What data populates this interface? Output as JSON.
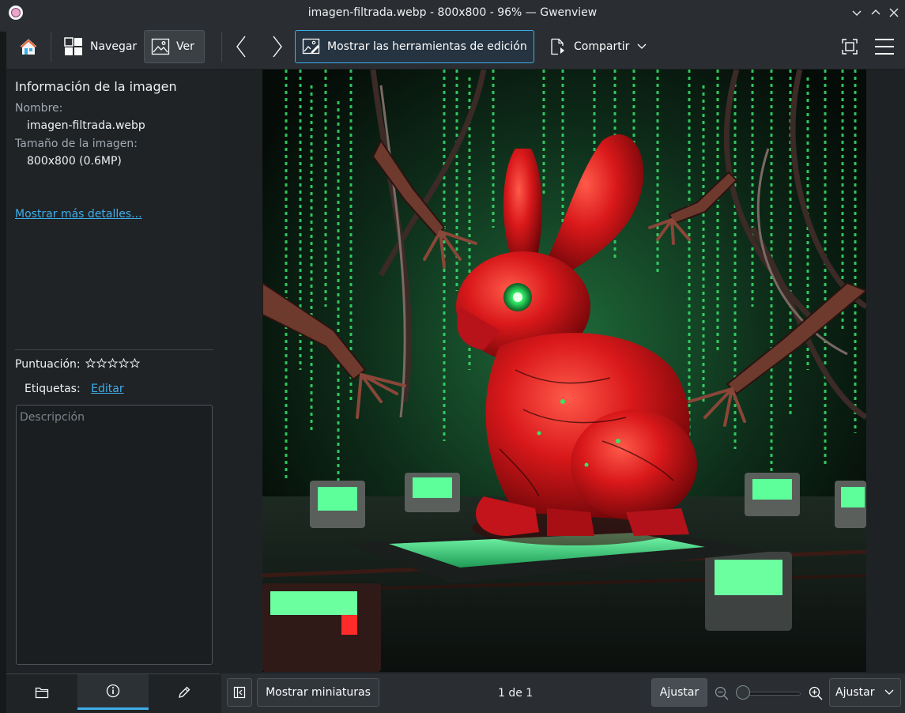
{
  "window": {
    "title": "imagen-filtrada.webp - 800x800 - 96% — Gwenview"
  },
  "toolbar": {
    "browse_label": "Navegar",
    "view_label": "Ver",
    "edit_tools_label": "Mostrar las herramientas de edición",
    "share_label": "Compartir"
  },
  "sidebar": {
    "section_title": "Información de la imagen",
    "name_label": "Nombre:",
    "name_value": "imagen-filtrada.webp",
    "size_label": "Tamaño de la imagen:",
    "size_value": "800x800 (0.6MP)",
    "more_details_link": "Mostrar más detalles...",
    "rating_label": "Puntuación:",
    "rating_value": 0,
    "rating_max": 5,
    "tags_label": "Etiquetas:",
    "tags_edit_link": "Editar",
    "description_placeholder": "Descripción"
  },
  "bottombar": {
    "thumbnails_label": "Mostrar miniaturas",
    "page_counter": "1 de 1",
    "fit_button_label": "Ajustar",
    "zoom_select_value": "Ajustar"
  },
  "icons": {
    "home": "home-icon",
    "browse": "grid-icon",
    "view": "image-icon",
    "previous": "chevron-left-icon",
    "next": "chevron-right-icon",
    "edit_tools": "image-edit-icon",
    "share": "share-icon",
    "fullscreen": "fullscreen-icon",
    "menu": "hamburger-menu-icon",
    "folder_tab": "folder-icon",
    "info_tab": "info-icon",
    "edit_tab": "pencil-icon",
    "sidebar_toggle": "sidebar-toggle-icon",
    "zoom_out": "zoom-out-icon",
    "zoom_in": "zoom-in-icon"
  },
  "colors": {
    "accent": "#3daee9",
    "window_bg": "#2a2e32",
    "panel_bg": "#202326",
    "image_bunny_red": "#d11a1a",
    "image_matrix_green": "#33e06a"
  }
}
